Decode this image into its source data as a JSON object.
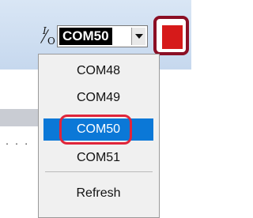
{
  "toolbar": {
    "io_icon": "io-port-icon",
    "combo_value": "COM50",
    "plug_icon": "plug-icon"
  },
  "dropdown": {
    "items": [
      {
        "label": "COM48",
        "selected": false
      },
      {
        "label": "COM49",
        "selected": false
      },
      {
        "label": "COM50",
        "selected": true
      },
      {
        "label": "COM51",
        "selected": false
      }
    ],
    "refresh_label": "Refresh"
  },
  "colors": {
    "selected": "#0b78d7",
    "highlight_ring": "#e0253a",
    "plug_button_border": "#8b0f25",
    "plug_icon": "#d61a1a"
  },
  "left_panel": {
    "dots": ". . ."
  }
}
